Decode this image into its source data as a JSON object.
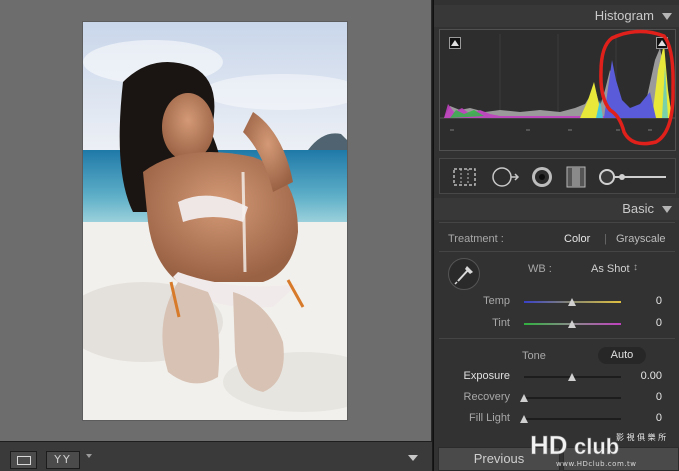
{
  "histogram": {
    "title": "Histogram"
  },
  "basic": {
    "title": "Basic",
    "treatment": {
      "label": "Treatment :",
      "color": "Color",
      "separator": "|",
      "grayscale": "Grayscale"
    },
    "wb": {
      "label": "WB :",
      "value": "As Shot",
      "arrows": "↕"
    },
    "temp": {
      "label": "Temp",
      "value": "0",
      "level": 0.5
    },
    "tint": {
      "label": "Tint",
      "value": "0",
      "level": 0.5
    },
    "tone": {
      "label": "Tone",
      "auto": "Auto"
    },
    "exposure": {
      "label": "Exposure",
      "value": "0.00",
      "level": 0.5
    },
    "recovery": {
      "label": "Recovery",
      "value": "0",
      "level": 0.0
    },
    "fill_light": {
      "label": "Fill Light",
      "value": "0",
      "level": 0.0
    }
  },
  "footer": {
    "previous": "Previous",
    "compare_label": "YY"
  },
  "watermark": {
    "logo": "HDclub",
    "site": "www.HDclub.com.tw"
  },
  "colors": {
    "panel_bg": "#323232",
    "viewer_bg": "#6d6d6d",
    "annotation_red": "#e0201a",
    "hist_blue": "#5a5bd8",
    "hist_yellow": "#e8e83a",
    "hist_magenta": "#c040c0"
  },
  "icons": [
    "crop-overlay-icon",
    "spot-removal-icon",
    "red-eye-icon",
    "graduated-filter-icon",
    "adjustment-brush-icon",
    "eyedropper-icon",
    "loupe-view-icon",
    "compare-view-icon"
  ]
}
